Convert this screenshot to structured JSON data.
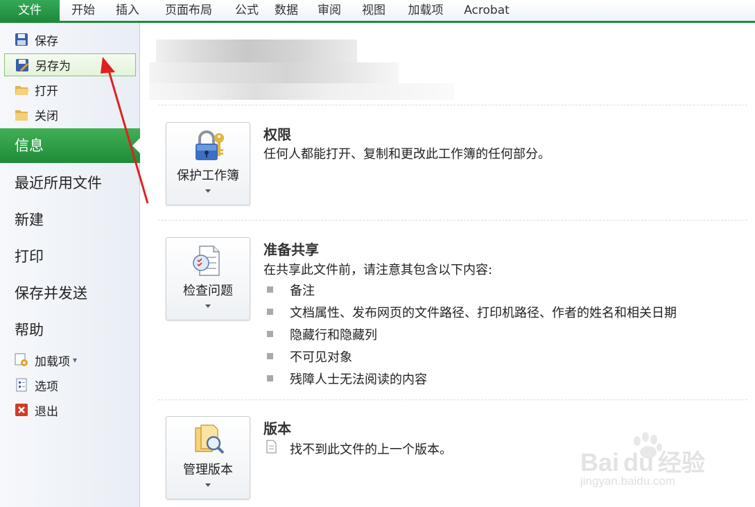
{
  "ribbon": {
    "tabs": [
      "文件",
      "开始",
      "插入",
      "页面布局",
      "公式",
      "数据",
      "审阅",
      "视图",
      "加载项",
      "Acrobat"
    ]
  },
  "sidebar": {
    "top_items": [
      {
        "label": "保存",
        "icon": "floppy-icon"
      },
      {
        "label": "另存为",
        "icon": "save-as-icon"
      },
      {
        "label": "打开",
        "icon": "open-folder-icon"
      },
      {
        "label": "关闭",
        "icon": "close-folder-icon"
      }
    ],
    "nav": [
      "信息",
      "最近所用文件",
      "新建",
      "打印",
      "保存并发送",
      "帮助"
    ],
    "bottom_items": [
      {
        "label": "加载项",
        "icon": "addins-icon",
        "dropdown": "▾"
      },
      {
        "label": "选项",
        "icon": "options-icon"
      },
      {
        "label": "退出",
        "icon": "exit-icon"
      }
    ]
  },
  "sections": {
    "permissions": {
      "button_label": "保护工作簿",
      "title": "权限",
      "text": "任何人都能打开、复制和更改此工作簿的任何部分。"
    },
    "prepare": {
      "button_label": "检查问题",
      "title": "准备共享",
      "text": "在共享此文件前，请注意其包含以下内容:",
      "bullets": [
        "备注",
        "文档属性、发布网页的文件路径、打印机路径、作者的姓名和相关日期",
        "隐藏行和隐藏列",
        "不可见对象",
        "残障人士无法阅读的内容"
      ]
    },
    "versions": {
      "button_label": "管理版本",
      "title": "版本",
      "text": "找不到此文件的上一个版本。"
    }
  },
  "watermark": {
    "brand": "Bai",
    "du": "du",
    "cn": "经验",
    "url": "jingyan.baidu.com"
  },
  "colors": {
    "accent_green": "#1d8b3a",
    "arrow_red": "#e02020"
  }
}
